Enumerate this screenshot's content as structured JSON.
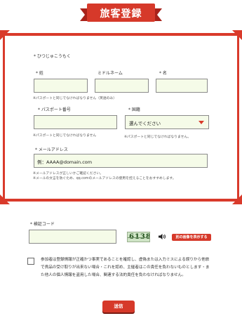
{
  "header": {
    "title": "旅客登録"
  },
  "form": {
    "furigana_label": "* ひつじゅこうもく",
    "last_name": {
      "label": "* 姓",
      "value": ""
    },
    "middle_name": {
      "label": "ミドルネーム",
      "value": ""
    },
    "first_name": {
      "label": "* 名",
      "value": ""
    },
    "name_note": "※パスポートと同じでなければなりません（英語のみ）",
    "passport": {
      "label": "* パスポート番号",
      "value": "",
      "note": "※パスポートと同じでなければなりません"
    },
    "nationality": {
      "label": "* 国籍",
      "value": "選んでください",
      "note": "※パスポートと同じでなければなりません。"
    },
    "email": {
      "label": "* メールアドレス",
      "value": "例：AAAA@domain.com",
      "note1": "※メールアドレスが正しいかご確認ください。",
      "note2": "※メールの文言を防ぐため、qq.comのメールアドレスの使用を控えることをおすすめします。"
    }
  },
  "verification": {
    "label": "* 検証コード",
    "value": "",
    "captcha_text": "6138",
    "refresh_label": "別の画像を表示する"
  },
  "agreement": {
    "checked": false,
    "text": "参加者は登録情報が正確かつ事実であることを確認し、虚偽または入力ミスによる誤りから他旅で貨品の受け取りが出来ない場合・これを認め、主催者はこの責任を負わないものとします・また他人の個人情報を盗用した場合、関連する法的責任を負わなければなりません。"
  },
  "actions": {
    "submit_label": "送信"
  },
  "colors": {
    "accent": "#d93a2b",
    "input_bg": "#f5fbe8"
  }
}
